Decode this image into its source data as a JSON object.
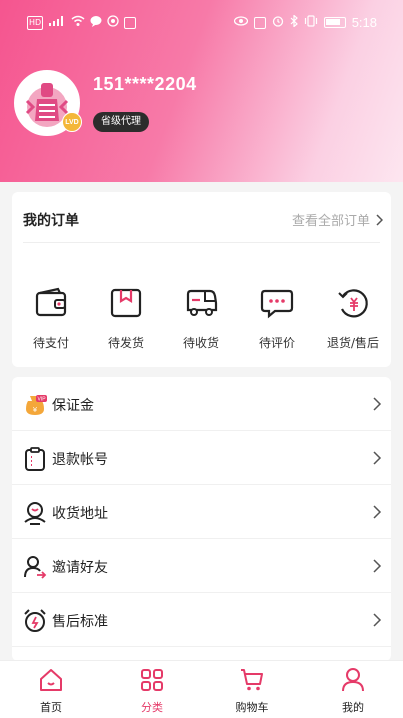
{
  "status_bar": {
    "left_icons": [
      "hd-icon",
      "signal-5g-icon",
      "wifi-icon",
      "message-icon",
      "location-icon",
      "app-icon"
    ],
    "signal_label": "HD",
    "right_icons": [
      "eye-icon",
      "nfc-icon",
      "alarm-icon",
      "bluetooth-icon",
      "vibrate-icon",
      "battery-icon"
    ],
    "time": "5:18"
  },
  "profile": {
    "phone": "151****2204",
    "level_badge": "省级代理",
    "badge_text": "LVD"
  },
  "orders": {
    "title": "我的订单",
    "view_all": "查看全部订单",
    "items": [
      {
        "label": "待支付",
        "icon": "wallet-icon"
      },
      {
        "label": "待发货",
        "icon": "package-icon"
      },
      {
        "label": "待收货",
        "icon": "truck-icon"
      },
      {
        "label": "待评价",
        "icon": "chat-icon"
      },
      {
        "label": "退货/售后",
        "icon": "refund-icon"
      }
    ]
  },
  "menu": {
    "items": [
      {
        "label": "保证金",
        "icon": "deposit-icon"
      },
      {
        "label": "退款帐号",
        "icon": "clipboard-icon"
      },
      {
        "label": "收货地址",
        "icon": "address-icon"
      },
      {
        "label": "邀请好友",
        "icon": "invite-icon"
      },
      {
        "label": "售后标准",
        "icon": "clock-icon"
      }
    ]
  },
  "tabbar": {
    "items": [
      {
        "label": "首页",
        "icon": "home-icon",
        "active": false
      },
      {
        "label": "分类",
        "icon": "grid-icon",
        "active": true
      },
      {
        "label": "购物车",
        "icon": "cart-icon",
        "active": false
      },
      {
        "label": "我的",
        "icon": "user-icon",
        "active": false
      }
    ]
  },
  "colors": {
    "accent": "#e53a68",
    "header_start": "#f5558f",
    "header_end": "#fde6f0"
  }
}
